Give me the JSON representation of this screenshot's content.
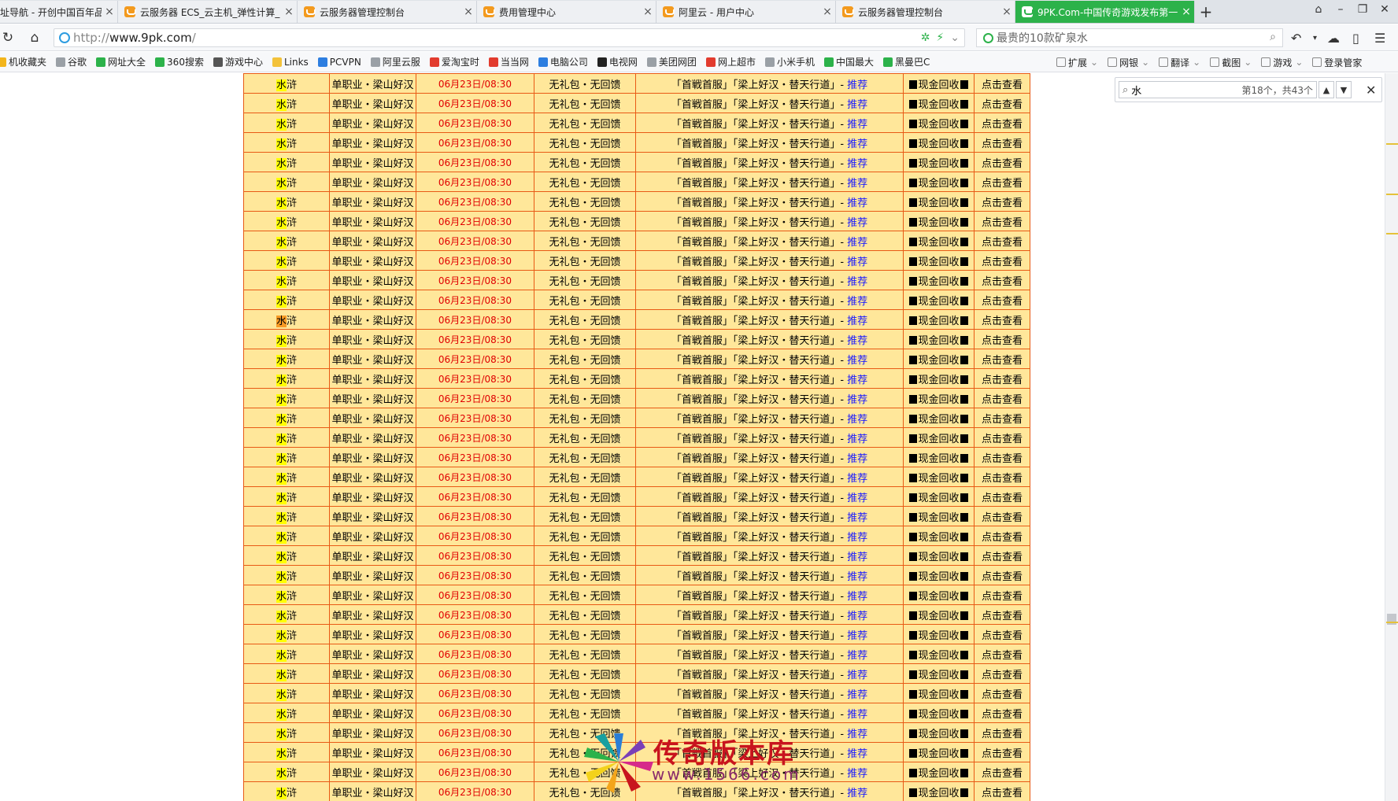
{
  "browser": {
    "tabs": [
      {
        "label": "址导航 - 开创中国百年品",
        "active": false
      },
      {
        "label": "云服务器 ECS_云主机_弹性计算_",
        "active": false
      },
      {
        "label": "云服务器管理控制台",
        "active": false
      },
      {
        "label": "费用管理中心",
        "active": false
      },
      {
        "label": "阿里云 - 用户中心",
        "active": false
      },
      {
        "label": "云服务器管理控制台",
        "active": false
      },
      {
        "label": "9PK.Com-中国传奇游戏发布第一",
        "active": true
      }
    ],
    "tab_close": "×",
    "new_tab": "+",
    "address": {
      "proto": "http://",
      "host": "www.9pk.com",
      "path": "/"
    },
    "search_placeholder": "最贵的10款矿泉水"
  },
  "bookmarks": {
    "left": [
      {
        "label": "机收藏夹",
        "icon": "star-icon",
        "color": "#f3b51b"
      },
      {
        "label": "谷歌",
        "icon": "page-icon",
        "color": "#9aa0a6"
      },
      {
        "label": "网址大全",
        "icon": "site-icon",
        "color": "#2cb24a"
      },
      {
        "label": "360搜索",
        "icon": "search-icon",
        "color": "#2cb24a"
      },
      {
        "label": "游戏中心",
        "icon": "gamepad-icon",
        "color": "#555555"
      },
      {
        "label": "Links",
        "icon": "folder-icon",
        "color": "#f3c23a"
      },
      {
        "label": "PCVPN",
        "icon": "vpn-icon",
        "color": "#2d7ee0"
      },
      {
        "label": "阿里云服",
        "icon": "page-icon",
        "color": "#9aa0a6"
      },
      {
        "label": "爱淘宝时",
        "icon": "taobao-icon",
        "color": "#e23b2e"
      },
      {
        "label": "当当网",
        "icon": "dangdang-icon",
        "color": "#e23b2e"
      },
      {
        "label": "电脑公司",
        "icon": "computer-icon",
        "color": "#2d7ee0"
      },
      {
        "label": "电视网",
        "icon": "tv-icon",
        "color": "#222222"
      },
      {
        "label": "美团网团",
        "icon": "page-icon",
        "color": "#9aa0a6"
      },
      {
        "label": "网上超市",
        "icon": "market-icon",
        "color": "#e23b2e"
      },
      {
        "label": "小米手机",
        "icon": "page-icon",
        "color": "#9aa0a6"
      },
      {
        "label": "中国最大",
        "icon": "china-icon",
        "color": "#2cb24a"
      },
      {
        "label": "黑曼巴C",
        "icon": "play-icon",
        "color": "#2cb24a"
      }
    ],
    "right": [
      {
        "label": "扩展",
        "icon": "grid-icon"
      },
      {
        "label": "网银",
        "icon": "bank-icon"
      },
      {
        "label": "翻译",
        "icon": "translate-icon"
      },
      {
        "label": "截图",
        "icon": "scissors-icon"
      },
      {
        "label": "游戏",
        "icon": "game-icon"
      },
      {
        "label": "登录管家",
        "icon": "login-icon"
      }
    ]
  },
  "find": {
    "query": "水",
    "count": "第18个，共43个"
  },
  "table": {
    "current_row": 12,
    "rows_count": 37,
    "row": {
      "name": "水浒",
      "job": "单职业・梁山好汉",
      "time": "06月23日/08:30",
      "feature": "无礼包・无回馈",
      "desc": "「首戦首服」「梁上好汉・替天行道」-",
      "recommend": "推荐",
      "recycle": "现金回收",
      "view": "点击查看"
    }
  },
  "watermark": {
    "title": "传奇版本库",
    "url": "www.1566.com"
  }
}
